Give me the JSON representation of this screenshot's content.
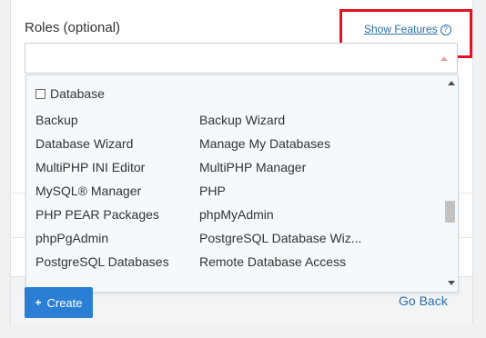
{
  "roles": {
    "label": "Roles (optional)",
    "show_features": "Show Features",
    "help_glyph": "?"
  },
  "dropdown": {
    "group": "Database",
    "options_left": [
      "Backup",
      "Database Wizard",
      "MultiPHP INI Editor",
      "MySQL® Manager",
      "PHP PEAR Packages",
      "phpPgAdmin",
      "PostgreSQL Databases"
    ],
    "options_right": [
      "Backup Wizard",
      "Manage My Databases",
      "MultiPHP Manager",
      "PHP",
      "phpMyAdmin",
      "PostgreSQL Database Wiz...",
      "Remote Database Access"
    ]
  },
  "actions": {
    "create_plus": "+",
    "create": "Create",
    "go_back": "Go Back"
  },
  "colors": {
    "highlight": "#e0141e",
    "primary": "#2a7fd4",
    "link": "#2a6fa6"
  }
}
